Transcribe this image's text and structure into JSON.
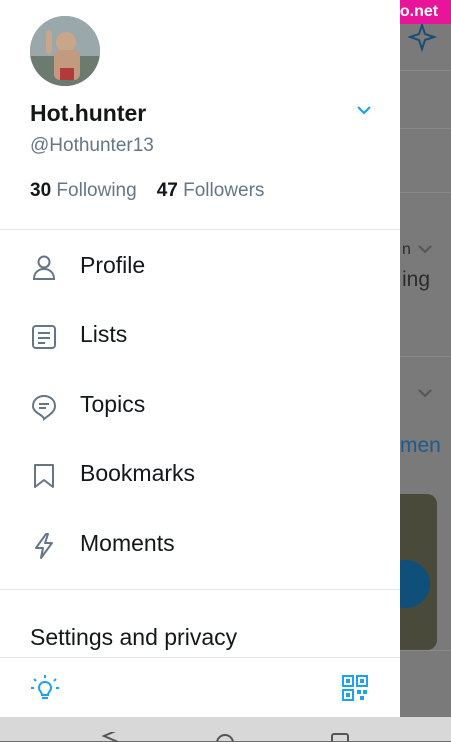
{
  "watermark": "fapellino.net",
  "profile": {
    "name": "Hot.hunter",
    "handle": "@Hothunter13",
    "following_count": "30",
    "following_label": "Following",
    "followers_count": "47",
    "followers_label": "Followers"
  },
  "menu": {
    "items": [
      {
        "label": "Profile",
        "icon": "person-icon"
      },
      {
        "label": "Lists",
        "icon": "list-icon"
      },
      {
        "label": "Topics",
        "icon": "topic-icon"
      },
      {
        "label": "Bookmarks",
        "icon": "bookmark-icon"
      },
      {
        "label": "Moments",
        "icon": "lightning-icon"
      }
    ],
    "settings_label": "Settings and privacy"
  },
  "background": {
    "text_fragment": "ing",
    "link_fragment": "men",
    "small_fragment": "n"
  },
  "colors": {
    "accent": "#1da1f2",
    "text_primary": "#14171a",
    "text_secondary": "#657786"
  },
  "icons": {
    "bottom_left": "lightbulb-icon",
    "bottom_right": "qr-code-icon",
    "top_right": "sparkle-icon"
  }
}
